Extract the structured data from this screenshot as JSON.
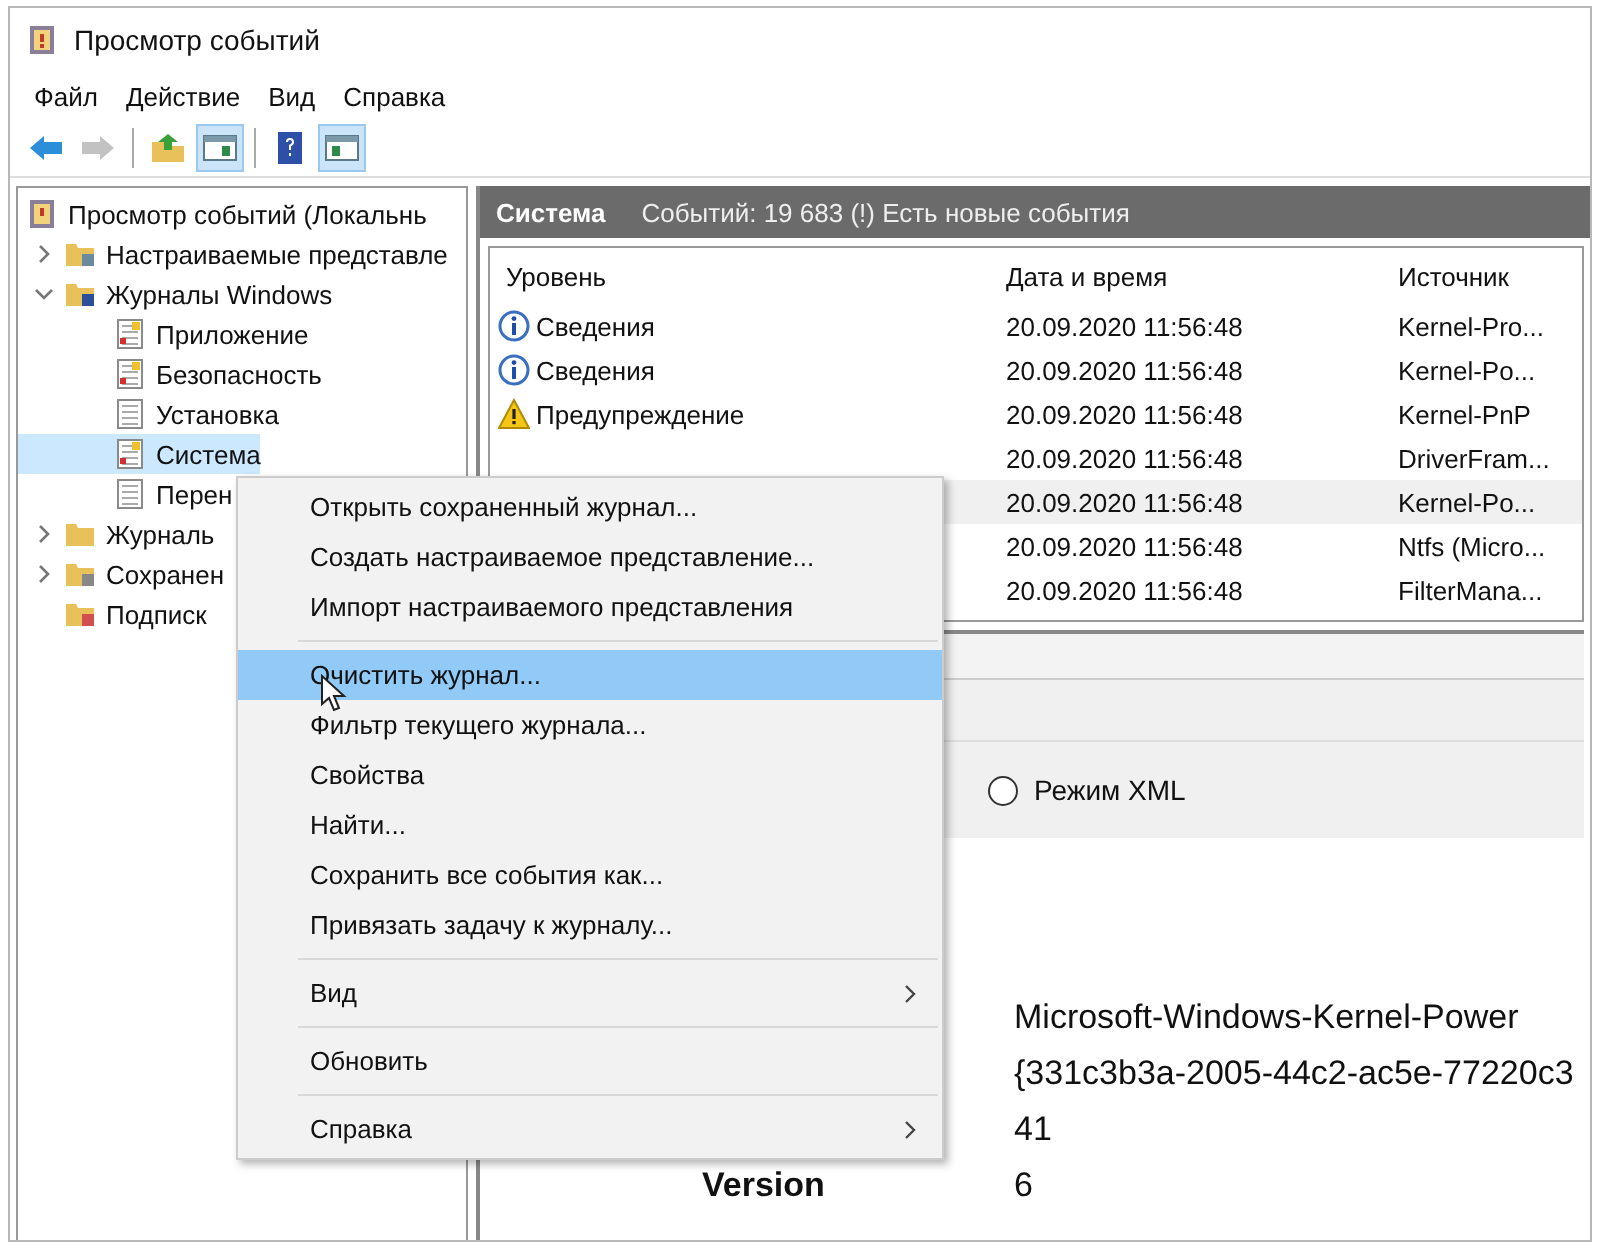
{
  "window": {
    "title": "Просмотр событий"
  },
  "menu_bar": [
    "Файл",
    "Действие",
    "Вид",
    "Справка"
  ],
  "toolbar": [
    {
      "kind": "back",
      "disabled": false,
      "pressed": false
    },
    {
      "kind": "forward",
      "disabled": true,
      "pressed": false
    },
    {
      "kind": "separator"
    },
    {
      "kind": "up",
      "disabled": false,
      "pressed": false
    },
    {
      "kind": "tree",
      "disabled": false,
      "pressed": true
    },
    {
      "kind": "separator"
    },
    {
      "kind": "help",
      "disabled": false,
      "pressed": false
    },
    {
      "kind": "actions",
      "disabled": false,
      "pressed": true
    }
  ],
  "tree": [
    {
      "label": "Просмотр событий (Локальнь",
      "selected": false,
      "children": [
        {
          "label": "Настраиваемые представле",
          "expanded": false,
          "selected": false
        },
        {
          "label": "Журналы Windows",
          "expanded": true,
          "selected": false,
          "children": [
            {
              "label": "Приложение",
              "selected": false
            },
            {
              "label": "Безопасность",
              "selected": false
            },
            {
              "label": "Установка",
              "selected": false
            },
            {
              "label": "Система",
              "selected": true
            },
            {
              "label": "Перен",
              "selected": false
            }
          ]
        },
        {
          "label": "Журналь",
          "expanded": false,
          "selected": false
        },
        {
          "label": "Сохранен",
          "expanded": false,
          "selected": false
        },
        {
          "label": "Подписк",
          "selected": false
        }
      ]
    }
  ],
  "log_header": {
    "title": "Система",
    "summary": "Событий: 19 683 (!) Есть новые события"
  },
  "table": {
    "columns": [
      "Уровень",
      "Дата и время",
      "Источник"
    ],
    "rows": [
      {
        "kind": "info",
        "level": "Сведения",
        "date": "20.09.2020 11:56:48",
        "source": "Kernel-Pro...",
        "selected": false
      },
      {
        "kind": "info",
        "level": "Сведения",
        "date": "20.09.2020 11:56:48",
        "source": "Kernel-Po...",
        "selected": false
      },
      {
        "kind": "warning",
        "level": "Предупреждение",
        "date": "20.09.2020 11:56:48",
        "source": "Kernel-PnP",
        "selected": false
      },
      {
        "date": "20.09.2020 11:56:48",
        "source": "DriverFram...",
        "selected": false
      },
      {
        "date": "20.09.2020 11:56:48",
        "source": "Kernel-Po...",
        "selected": true
      },
      {
        "date": "20.09.2020 11:56:48",
        "source": "Ntfs (Micro...",
        "selected": false
      },
      {
        "date": "20.09.2020 11:56:48",
        "source": "FilterMana...",
        "selected": false
      }
    ]
  },
  "view_mode": {
    "label": "Режим XML",
    "checked": false
  },
  "details": [
    {
      "value": "Microsoft-Windows-Kernel-Power"
    },
    {
      "value": "{331c3b3a-2005-44c2-ac5e-77220c3"
    },
    {
      "value": "41"
    },
    {
      "label": "Version",
      "value": "6"
    }
  ],
  "context_menu": [
    {
      "kind": "item",
      "label": "Открыть сохраненный журнал...",
      "selected": false,
      "submenu": false
    },
    {
      "kind": "item",
      "label": "Создать настраиваемое представление...",
      "selected": false,
      "submenu": false
    },
    {
      "kind": "item",
      "label": "Импорт настраиваемого представления",
      "selected": false,
      "submenu": false
    },
    {
      "kind": "separator"
    },
    {
      "kind": "item",
      "label": "Очистить журнал...",
      "selected": true,
      "submenu": false
    },
    {
      "kind": "item",
      "label": "Фильтр текущего журнала...",
      "selected": false,
      "submenu": false
    },
    {
      "kind": "item",
      "label": "Свойства",
      "selected": false,
      "submenu": false
    },
    {
      "kind": "item",
      "label": "Найти...",
      "selected": false,
      "submenu": false
    },
    {
      "kind": "item",
      "label": "Сохранить все события как...",
      "selected": false,
      "submenu": false
    },
    {
      "kind": "item",
      "label": "Привязать задачу к журналу...",
      "selected": false,
      "submenu": false
    },
    {
      "kind": "separator"
    },
    {
      "kind": "item",
      "label": "Вид",
      "selected": false,
      "submenu": true
    },
    {
      "kind": "separator"
    },
    {
      "kind": "item",
      "label": "Обновить",
      "selected": false,
      "submenu": false
    },
    {
      "kind": "separator"
    },
    {
      "kind": "item",
      "label": "Справка",
      "selected": false,
      "submenu": true
    }
  ]
}
